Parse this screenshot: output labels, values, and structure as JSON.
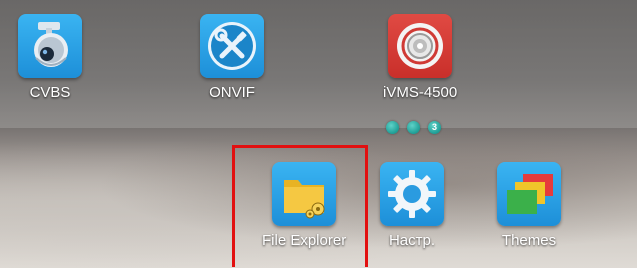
{
  "apps": {
    "cvbs": {
      "label": "CVBS",
      "icon": "dome-camera-icon"
    },
    "onvif": {
      "label": "ONVIF",
      "icon": "tools-icon"
    },
    "ivms": {
      "label": "iVMS-4500",
      "icon": "camera-lens-icon"
    },
    "files": {
      "label": "File Explorer",
      "icon": "folder-icon"
    },
    "settings": {
      "label": "Настр.",
      "icon": "gear-icon"
    },
    "themes": {
      "label": "Themes",
      "icon": "themes-icon"
    }
  },
  "pager": {
    "current": "3"
  },
  "colors": {
    "highlight": "#e21010",
    "tile_blue": "#2aa3e6",
    "tile_red": "#d63b35"
  }
}
